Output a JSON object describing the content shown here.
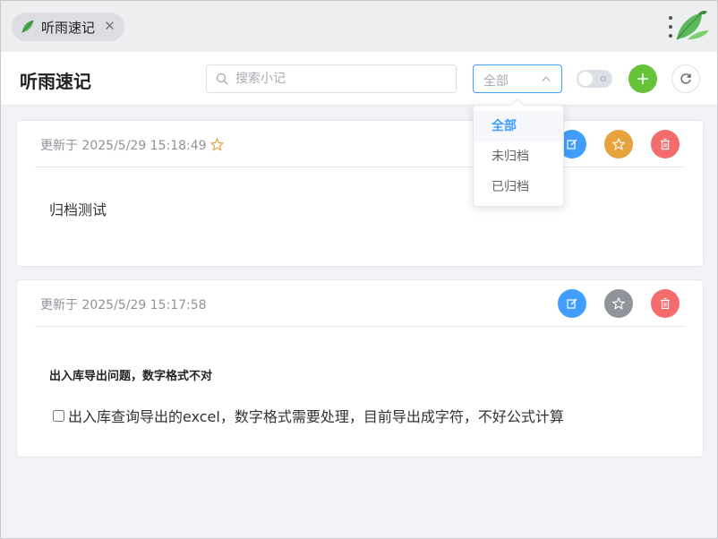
{
  "tab": {
    "title": "听雨速记",
    "close_icon": "close-icon"
  },
  "window": {
    "more_icon": "more-vertical-icon",
    "logo_icon": "bird-logo-icon"
  },
  "header": {
    "title": "听雨速记",
    "search": {
      "placeholder": "搜索小记",
      "value": "",
      "icon": "search-icon"
    },
    "filter": {
      "selected": "全部",
      "options": [
        "全部",
        "未归档",
        "已归档"
      ]
    },
    "archive_toggle": {
      "on": false
    },
    "add_icon": "plus-icon",
    "refresh_icon": "refresh-icon"
  },
  "notes": [
    {
      "updated": "更新于 2025/5/29 15:18:49",
      "starred": true,
      "content": "归档测试"
    },
    {
      "updated": "更新于 2025/5/29 15:17:58",
      "starred": false,
      "heading": "出入库导出问题，数字格式不对",
      "task": {
        "checked": false,
        "text": "出入库查询导出的excel，数字格式需要处理，目前导出成字符，不好公式计算"
      }
    }
  ],
  "colors": {
    "primary": "#409eff",
    "success": "#67c23a",
    "warning": "#e6a23c",
    "danger": "#f56c6c",
    "muted": "#909399",
    "brand_green": "#4caf50"
  }
}
